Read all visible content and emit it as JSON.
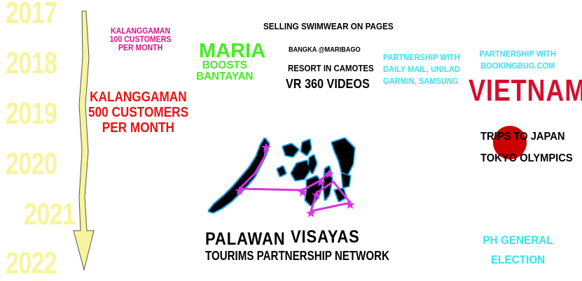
{
  "years": [
    "2017",
    "2018",
    "2019",
    "2020",
    "2021",
    "2022"
  ],
  "milestones": {
    "kalanggaman_100": [
      "KALANGGAMAN",
      "100 CUSTOMERS",
      "PER MONTH"
    ],
    "kalanggaman_500": [
      "KALANGGAMAN",
      "500 CUSTOMERS",
      "PER MONTH"
    ],
    "maria_title": "MARIA",
    "maria_sub": [
      "BOOSTS",
      "BANTAYAN"
    ],
    "swimwear": "SELLING SWIMWEAR ON PAGES",
    "bangka": "BANGKA @MARIBAGO",
    "resort": "RESORT IN CAMOTES",
    "vr": "VR 360 VIDEOS",
    "partnership_media": [
      "PARTNERSHIP WITH",
      "DAILY MAIL, UNILAD",
      "GARMIN, SAMSUNG"
    ],
    "partnership_booking": [
      "PARTNERSHIP WITH",
      "BOOKINGBUG.COM"
    ],
    "vietnam": "VIETNAM",
    "japan": [
      "TRIPS TO JAPAN",
      "TOKYO OLYMPICS"
    ],
    "palawan": "PALAWAN",
    "visayas": "VISAYAS",
    "network": "TOURIMS PARTNERSHIP NETWORK",
    "election": [
      "PH GENERAL",
      "ELECTION"
    ]
  },
  "colors": {
    "year": "#f7f59b",
    "magenta": "#d4148c",
    "red": "#ee1111",
    "green": "#44ee22",
    "cyan": "#33e6ee",
    "black": "#000000",
    "route": "#d733e8",
    "japan_sun": "#cc0000"
  },
  "icons": [
    "timeline-arrow",
    "philippines-map",
    "japan-sun-circle"
  ]
}
